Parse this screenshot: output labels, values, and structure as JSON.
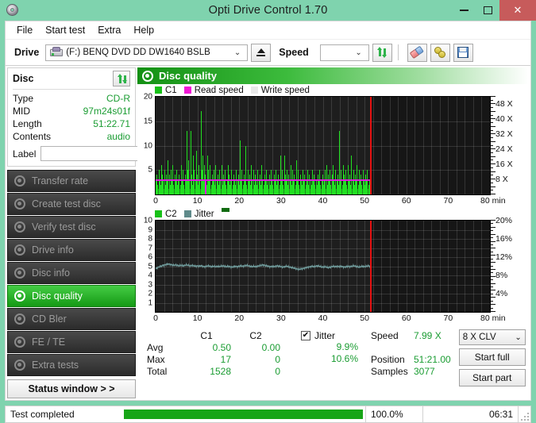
{
  "window": {
    "title": "Opti Drive Control 1.70",
    "icon": "disc-icon",
    "minimize": "–",
    "maximize": "□",
    "close": "✕"
  },
  "menu": {
    "items": [
      {
        "label": "File"
      },
      {
        "label": "Start test"
      },
      {
        "label": "Extra"
      },
      {
        "label": "Help"
      }
    ]
  },
  "toolbar": {
    "drive_label": "Drive",
    "drive_value": "(F:)   BENQ DVD DD DW1640 BSLB",
    "eject_icon": "eject-icon",
    "speed_label": "Speed",
    "speed_value": "",
    "refresh_icon": "swap-arrows-icon",
    "erase_icon": "eraser-icon",
    "tools_icon": "tools-icon",
    "save_icon": "save-icon"
  },
  "sidebar": {
    "disc_panel": {
      "title": "Disc",
      "refresh_icon": "swap-arrows-icon",
      "rows": [
        {
          "key": "Type",
          "value": "CD-R"
        },
        {
          "key": "MID",
          "value": "97m24s01f"
        },
        {
          "key": "Length",
          "value": "51:22.71"
        },
        {
          "key": "Contents",
          "value": "audio"
        }
      ],
      "label_key": "Label",
      "label_value": "",
      "label_placeholder": "",
      "label_button_icon": "cd-icon"
    },
    "nav": [
      {
        "label": "Transfer rate",
        "icon": "disc-icon",
        "active": false
      },
      {
        "label": "Create test disc",
        "icon": "disc-icon",
        "active": false
      },
      {
        "label": "Verify test disc",
        "icon": "disc-icon",
        "active": false
      },
      {
        "label": "Drive info",
        "icon": "disc-icon",
        "active": false
      },
      {
        "label": "Disc info",
        "icon": "disc-icon",
        "active": false
      },
      {
        "label": "Disc quality",
        "icon": "disc-icon",
        "active": true
      },
      {
        "label": "CD Bler",
        "icon": "disc-icon",
        "active": false
      },
      {
        "label": "FE / TE",
        "icon": "disc-icon",
        "active": false
      },
      {
        "label": "Extra tests",
        "icon": "disc-icon",
        "active": false
      }
    ],
    "status_window_button": "Status window > >"
  },
  "main": {
    "panel_title": "Disc quality",
    "panel_icon": "disc-icon"
  },
  "chart_data": [
    {
      "type": "bar",
      "name": "c1-chart",
      "title": "",
      "xlabel": "min",
      "ylabel": "C1",
      "xlim": [
        0,
        80
      ],
      "ylim": [
        0,
        20
      ],
      "xticks": [
        0,
        10,
        20,
        30,
        40,
        50,
        60,
        70,
        80
      ],
      "xticklabels": [
        "0",
        "10",
        "20",
        "30",
        "40",
        "50",
        "60",
        "70",
        "80 min"
      ],
      "yticks": [
        5,
        10,
        15,
        20
      ],
      "yticklabels": [
        "5",
        "10",
        "15",
        "20"
      ],
      "right_axis_label": "X",
      "right_ticks": [
        8,
        16,
        24,
        32,
        40,
        48
      ],
      "right_ticklabels": [
        "8 X",
        "16 X",
        "24 X",
        "32 X",
        "40 X",
        "48 X"
      ],
      "right_lim": [
        0,
        52
      ],
      "grid": true,
      "legend": [
        {
          "label": "C1",
          "color": "#18c018"
        },
        {
          "label": "Read speed",
          "color": "#f218d6"
        },
        {
          "label": "Write speed",
          "color": "#e8e8e8"
        }
      ],
      "data_end_min": 51.3,
      "cursor_min": 51.3,
      "read_speed_value_x": 8,
      "values": [
        3,
        4,
        2,
        5,
        3,
        2,
        6,
        4,
        3,
        5,
        2,
        4,
        3,
        7,
        4,
        2,
        5,
        3,
        6,
        2,
        4,
        3,
        5,
        2,
        3,
        4,
        2,
        6,
        3,
        5,
        2,
        4,
        3,
        13,
        5,
        7,
        3,
        13,
        4,
        2,
        8,
        5,
        3,
        9,
        4,
        2,
        6,
        3,
        17,
        5,
        8,
        3,
        6,
        4,
        2,
        8,
        5,
        3,
        6,
        2,
        4,
        3,
        5,
        2,
        6,
        3,
        4,
        2,
        5,
        3,
        6,
        2,
        4,
        3,
        5,
        2,
        3,
        6,
        4,
        2,
        3,
        5,
        2,
        4,
        3,
        2,
        5,
        3,
        4,
        2,
        11,
        3,
        5,
        2,
        4,
        3,
        10,
        2,
        5,
        3,
        4,
        2,
        6,
        3,
        5,
        2,
        4,
        3,
        2,
        5,
        3,
        4,
        2,
        6,
        3,
        2,
        4,
        3,
        5,
        2,
        3,
        4,
        2,
        5,
        3,
        2,
        4,
        3,
        5,
        2,
        3,
        4,
        2,
        8,
        3,
        5,
        2,
        8,
        4,
        3,
        5,
        2,
        4,
        3,
        6,
        2,
        5,
        3,
        4,
        2,
        7,
        3,
        5,
        2,
        4,
        3,
        2,
        5,
        3,
        4,
        2,
        3,
        5,
        2,
        4,
        3,
        2,
        5,
        3,
        4,
        2,
        3,
        2,
        4,
        3,
        5,
        2,
        3,
        4,
        2,
        3,
        5,
        6,
        2,
        4,
        3,
        5,
        2,
        4,
        6,
        3,
        2,
        5,
        3,
        4,
        2,
        13,
        3,
        5,
        2,
        6,
        4,
        3,
        5,
        2,
        6,
        3,
        4,
        2,
        8,
        3,
        5,
        2,
        4,
        3,
        6,
        2,
        5,
        3,
        4,
        2,
        5,
        3,
        2,
        4,
        3,
        5,
        2,
        3
      ],
      "avg": 0.5,
      "max": 17,
      "total": 1528
    },
    {
      "type": "line",
      "name": "c2-jitter-chart",
      "title": "",
      "xlabel": "min",
      "ylabel": "C2",
      "xlim": [
        0,
        80
      ],
      "ylim": [
        0,
        10
      ],
      "xticks": [
        0,
        10,
        20,
        30,
        40,
        50,
        60,
        70,
        80
      ],
      "xticklabels": [
        "0",
        "10",
        "20",
        "30",
        "40",
        "50",
        "60",
        "70",
        "80 min"
      ],
      "yticks": [
        1,
        2,
        3,
        4,
        5,
        6,
        7,
        8,
        9,
        10
      ],
      "yticklabels": [
        "1",
        "2",
        "3",
        "4",
        "5",
        "6",
        "7",
        "8",
        "9",
        "10"
      ],
      "right_ticks": [
        4,
        8,
        12,
        16,
        20
      ],
      "right_ticklabels": [
        "4%",
        "8%",
        "12%",
        "16%",
        "20%"
      ],
      "right_lim": [
        0,
        20
      ],
      "grid": true,
      "legend": [
        {
          "label": "C2",
          "color": "#18c018"
        },
        {
          "label": "Jitter",
          "color": "#5f8a8a"
        }
      ],
      "data_end_min": 51.3,
      "cursor_min": 51.3,
      "series": [
        {
          "name": "Jitter",
          "color": "#6f9a9a",
          "values_pct": [
            9.4,
            9.7,
            9.9,
            10.0,
            10.2,
            10.3,
            10.4,
            10.5,
            10.4,
            10.3,
            10.2,
            10.3,
            10.2,
            10.1,
            10.2,
            10.1,
            10.2,
            10.3,
            10.2,
            10.1,
            10.2,
            10.1,
            10.0,
            10.1,
            10.0,
            10.1,
            10.0,
            9.9,
            10.0,
            10.1,
            10.0,
            9.9,
            10.0,
            9.9,
            10.0,
            9.9,
            10.0,
            10.1,
            10.0,
            9.9,
            10.0,
            9.9,
            9.8,
            9.9,
            10.0,
            9.9,
            10.0,
            10.1,
            10.0,
            10.1,
            10.2,
            10.1,
            10.0,
            9.9,
            10.0,
            9.9,
            10.0,
            10.1,
            10.2,
            10.3,
            10.2,
            10.1,
            10.0,
            9.9,
            10.0,
            9.9,
            10.0,
            10.1,
            10.0,
            9.9,
            9.8,
            9.9,
            10.0,
            9.9,
            9.8,
            9.7,
            9.6,
            9.5,
            9.4,
            9.3,
            9.4,
            9.5,
            9.6,
            9.7,
            9.8,
            9.9,
            10.0,
            9.9,
            10.0,
            10.1,
            10.0,
            9.9,
            9.8,
            9.9,
            9.8,
            9.7,
            9.8,
            9.9,
            10.0,
            9.9,
            10.0,
            9.9,
            10.0,
            9.9,
            9.8,
            9.9,
            10.0,
            9.9,
            10.0,
            10.1,
            10.0,
            9.9,
            9.8,
            9.9,
            10.0,
            9.9,
            10.0,
            10.1,
            10.0
          ]
        }
      ],
      "avg": 0.0,
      "max": 0,
      "total": 0
    }
  ],
  "stats": {
    "columns": [
      "C1",
      "C2"
    ],
    "rows": [
      {
        "label": "Avg",
        "c1": "0.50",
        "c2": "0.00"
      },
      {
        "label": "Max",
        "c1": "17",
        "c2": "0"
      },
      {
        "label": "Total",
        "c1": "1528",
        "c2": "0"
      }
    ],
    "jitter": {
      "checked": true,
      "check_glyph": "✔",
      "label": "Jitter",
      "avg": "9.9%",
      "max": "10.6%"
    },
    "speed": {
      "label": "Speed",
      "value": "7.99 X",
      "position_label": "Position",
      "position_value": "51:21.00",
      "samples_label": "Samples",
      "samples_value": "3077"
    },
    "controls": {
      "speed_select": "8 X CLV",
      "start_full": "Start full",
      "start_part": "Start part"
    }
  },
  "statusbar": {
    "text": "Test completed",
    "progress_pct": 100,
    "progress_label": "100.0%",
    "time": "06:31"
  },
  "colors": {
    "accent_green": "#17a517",
    "value_green": "#1a9c32",
    "c1_bar": "#22e022",
    "read_speed": "#e019e0",
    "jitter": "#6f9a9a",
    "cursor_red": "#e51111",
    "titlebar": "#7fd3ae",
    "close_button": "#c75b5b"
  }
}
